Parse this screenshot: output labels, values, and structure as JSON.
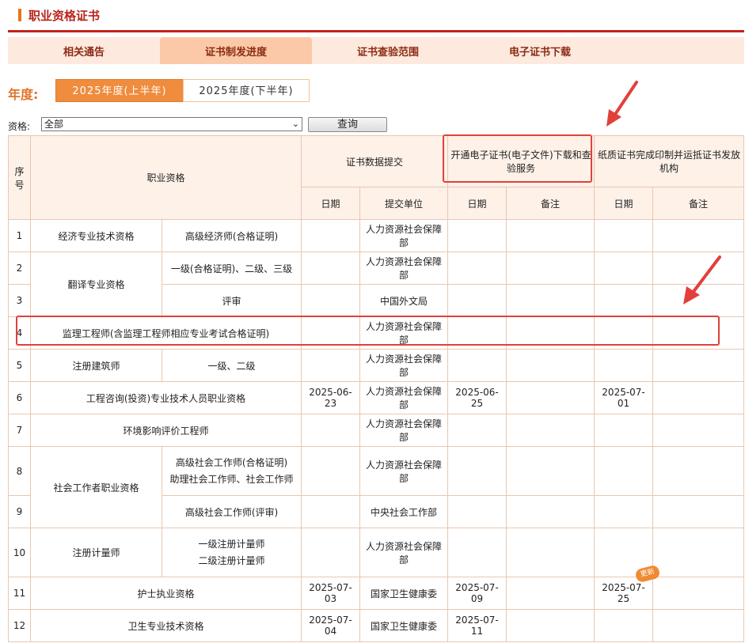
{
  "header": {
    "title": "职业资格证书"
  },
  "tabs": [
    {
      "label": "相关通告"
    },
    {
      "label": "证书制发进度"
    },
    {
      "label": "证书查验范围"
    },
    {
      "label": "电子证书下载"
    }
  ],
  "year": {
    "label": "年度:",
    "options": [
      "2025年度(上半年)",
      "2025年度(下半年)"
    ]
  },
  "filter": {
    "label": "资格:",
    "selected": "全部",
    "query_label": "查询"
  },
  "table": {
    "headers": {
      "seq": "序号",
      "qualification": "职业资格",
      "submit_group": "证书数据提交",
      "ecert_group": "开通电子证书(电子文件)下载和查验服务",
      "paper_group": "纸质证书完成印制并运抵证书发放机构",
      "date": "日期",
      "unit": "提交单位",
      "note": "备注"
    },
    "rows": [
      {
        "seq": "1",
        "category": "经济专业技术资格",
        "sub": "高级经济师(合格证明)",
        "submit_date": "",
        "unit": "人力资源社会保障部",
        "ecert_date": "",
        "ecert_note": "",
        "paper_date": "",
        "paper_note": ""
      },
      {
        "seq": "2",
        "category": "翻译专业资格",
        "sub": "一级(合格证明)、二级、三级",
        "submit_date": "",
        "unit": "人力资源社会保障部",
        "ecert_date": "",
        "ecert_note": "",
        "paper_date": "",
        "paper_note": ""
      },
      {
        "seq": "3",
        "category": "",
        "sub": "评审",
        "submit_date": "",
        "unit": "中国外文局",
        "ecert_date": "",
        "ecert_note": "",
        "paper_date": "",
        "paper_note": ""
      },
      {
        "seq": "4",
        "category": "监理工程师(含监理工程师相应专业考试合格证明)",
        "sub": "",
        "submit_date": "",
        "unit": "人力资源社会保障部",
        "ecert_date": "",
        "ecert_note": "",
        "paper_date": "",
        "paper_note": ""
      },
      {
        "seq": "5",
        "category": "注册建筑师",
        "sub": "一级、二级",
        "submit_date": "",
        "unit": "人力资源社会保障部",
        "ecert_date": "",
        "ecert_note": "",
        "paper_date": "",
        "paper_note": ""
      },
      {
        "seq": "6",
        "category": "工程咨询(投资)专业技术人员职业资格",
        "sub": "",
        "submit_date": "2025-06-23",
        "unit": "人力资源社会保障部",
        "ecert_date": "2025-06-25",
        "ecert_note": "",
        "paper_date": "2025-07-01",
        "paper_note": ""
      },
      {
        "seq": "7",
        "category": "环境影响评价工程师",
        "sub": "",
        "submit_date": "",
        "unit": "人力资源社会保障部",
        "ecert_date": "",
        "ecert_note": "",
        "paper_date": "",
        "paper_note": ""
      },
      {
        "seq": "8",
        "category": "社会工作者职业资格",
        "sub": "高级社会工作师(合格证明)",
        "sub2": "助理社会工作师、社会工作师",
        "submit_date": "",
        "unit": "人力资源社会保障部",
        "ecert_date": "",
        "ecert_note": "",
        "paper_date": "",
        "paper_note": ""
      },
      {
        "seq": "9",
        "category": "",
        "sub": "高级社会工作师(评审)",
        "submit_date": "",
        "unit": "中央社会工作部",
        "ecert_date": "",
        "ecert_note": "",
        "paper_date": "",
        "paper_note": ""
      },
      {
        "seq": "10",
        "category": "注册计量师",
        "sub": "一级注册计量师",
        "sub2": "二级注册计量师",
        "submit_date": "",
        "unit": "人力资源社会保障部",
        "ecert_date": "",
        "ecert_note": "",
        "paper_date": "",
        "paper_note": ""
      },
      {
        "seq": "11",
        "category": "护士执业资格",
        "sub": "",
        "submit_date": "2025-07-03",
        "unit": "国家卫生健康委",
        "ecert_date": "2025-07-09",
        "ecert_note": "",
        "paper_date": "2025-07-25",
        "paper_note": ""
      },
      {
        "seq": "12",
        "category": "卫生专业技术资格",
        "sub": "",
        "submit_date": "2025-07-04",
        "unit": "国家卫生健康委",
        "ecert_date": "2025-07-11",
        "ecert_note": "",
        "paper_date": "",
        "paper_note": ""
      }
    ]
  },
  "badge": {
    "label": "更新"
  },
  "colors": {
    "accent": "#e8741c",
    "header_line": "#c4221a",
    "tab_bg": "#fde9de",
    "tab_active": "#fbc9a7",
    "highlight": "#e2403b"
  }
}
